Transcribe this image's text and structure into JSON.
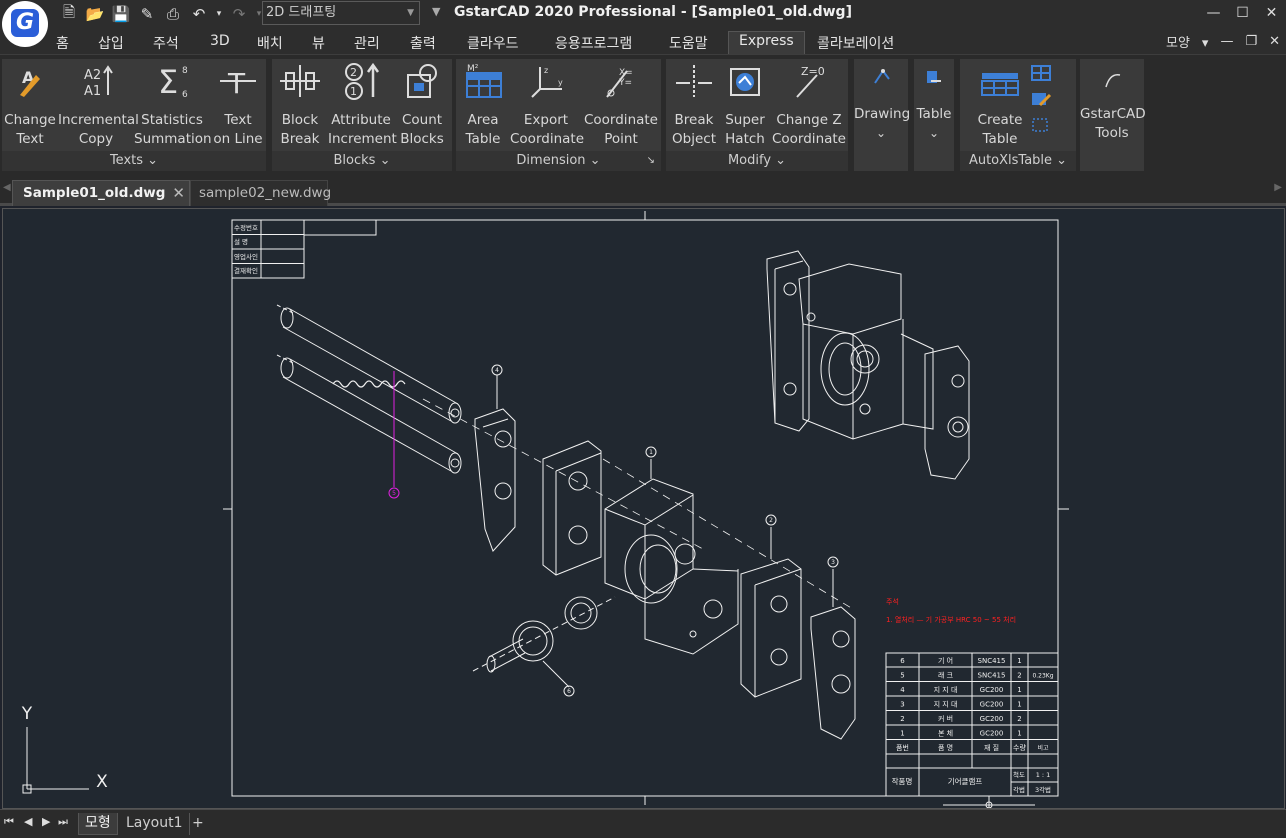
{
  "app": {
    "title": "GstarCAD 2020 Professional - [Sample01_old.dwg]",
    "logo_letter": "G",
    "workspace": "2D 드래프팅"
  },
  "menu": {
    "items": [
      "홈",
      "삽입",
      "주석",
      "3D",
      "배치",
      "뷰",
      "관리",
      "출력",
      "클라우드",
      "응용프로그램",
      "도움말",
      "Express",
      "콜라보레이션"
    ],
    "active": "Express",
    "right_label": "모양"
  },
  "ribbon": {
    "panels": [
      {
        "title": "Texts",
        "tools": [
          "Change\nText",
          "Incremental\nCopy",
          "Statistics\nSummation",
          "Text\non Line"
        ]
      },
      {
        "title": "Blocks",
        "tools": [
          "Block\nBreak",
          "Attribute\nIncrement",
          "Count\nBlocks"
        ]
      },
      {
        "title": "Dimension",
        "tools": [
          "Area\nTable",
          "Export\nCoordinate",
          "Coordinate\nPoint"
        ]
      },
      {
        "title": "Modify",
        "tools": [
          "Break\nObject",
          "Super\nHatch",
          "Change Z\nCoordinate"
        ]
      },
      {
        "title": "",
        "tools": [
          "Drawing"
        ]
      },
      {
        "title": "",
        "tools": [
          "Table"
        ]
      },
      {
        "title": "AutoXlsTable",
        "tools": [
          "Create\nTable"
        ]
      },
      {
        "title": "",
        "tools": [
          "GstarCAD\nTools"
        ]
      }
    ]
  },
  "doc_tabs": {
    "active": "Sample01_old.dwg",
    "inactive": "sample02_new.dwg"
  },
  "drawing": {
    "revision_table": [
      "수정번호",
      "설    명",
      "영업사인",
      "결재확인"
    ],
    "balloons": [
      "4",
      "1",
      "2",
      "3",
      "5",
      "6"
    ],
    "note_title": "주석",
    "note_line": "1. 열처리 — 기 가공부 HRC 50 ~ 55 처리",
    "bom_rows": [
      {
        "no": "6",
        "name": "기    어",
        "mat": "SNC415",
        "qty": "1",
        "note": ""
      },
      {
        "no": "5",
        "name": "래    크",
        "mat": "SNC415",
        "qty": "2",
        "note": "0.23Kg"
      },
      {
        "no": "4",
        "name": "지 지 대",
        "mat": "GC200",
        "qty": "1",
        "note": ""
      },
      {
        "no": "3",
        "name": "지 지 대",
        "mat": "GC200",
        "qty": "1",
        "note": ""
      },
      {
        "no": "2",
        "name": "커    버",
        "mat": "GC200",
        "qty": "2",
        "note": ""
      },
      {
        "no": "1",
        "name": "본    체",
        "mat": "GC200",
        "qty": "1",
        "note": ""
      }
    ],
    "bom_header": {
      "no": "품번",
      "name": "품    명",
      "mat": "재    질",
      "qty": "수량",
      "note": "비고"
    },
    "title_block": {
      "label": "작품명",
      "name": "기어클램프",
      "scale_label": "척도",
      "scale": "1 : 1",
      "proj_label": "각법",
      "proj": "3각법"
    },
    "ucs": {
      "y": "Y",
      "x": "X"
    }
  },
  "layout_tabs": {
    "active": "모형",
    "inactive": "Layout1",
    "add": "+"
  }
}
